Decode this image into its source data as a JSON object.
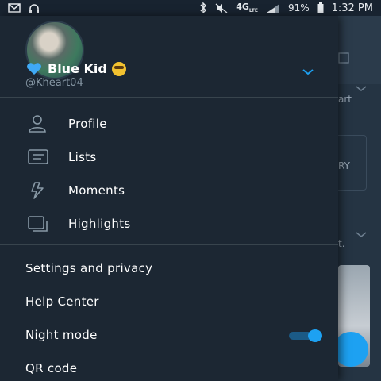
{
  "status_bar": {
    "network": "4G",
    "network_sub": "LTE",
    "battery": "91%",
    "time": "1:32 PM"
  },
  "background_app": {
    "snippet_1": "art",
    "snippet_2": "RY",
    "snippet_3": "t."
  },
  "profile": {
    "display_name": "Blue Kid",
    "handle": "@Kheart04"
  },
  "menu": {
    "items": [
      {
        "label": "Profile",
        "icon": "person-icon"
      },
      {
        "label": "Lists",
        "icon": "list-icon"
      },
      {
        "label": "Moments",
        "icon": "lightning-icon"
      },
      {
        "label": "Highlights",
        "icon": "highlights-icon"
      }
    ]
  },
  "settings": {
    "items": [
      {
        "label": "Settings and privacy"
      },
      {
        "label": "Help Center"
      },
      {
        "label": "Night mode",
        "toggle_on": true
      },
      {
        "label": "QR code"
      }
    ]
  },
  "colors": {
    "drawer_bg": "#1c2733",
    "accent": "#1da1f2",
    "secondary_text": "#8899a6",
    "divider": "#38444d"
  }
}
